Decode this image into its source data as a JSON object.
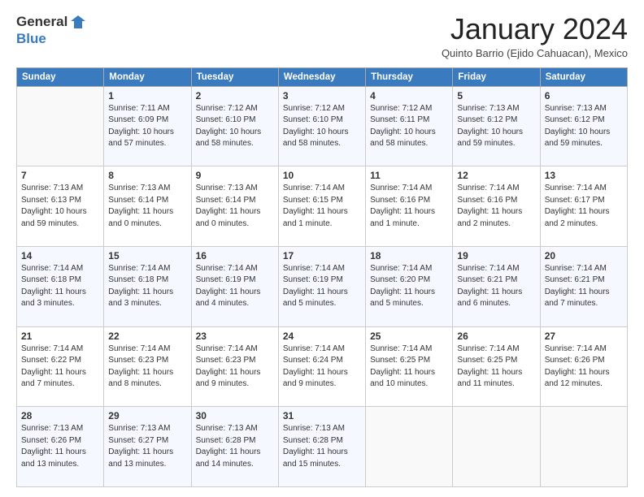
{
  "logo": {
    "general": "General",
    "blue": "Blue"
  },
  "title": "January 2024",
  "location": "Quinto Barrio (Ejido Cahuacan), Mexico",
  "days_header": [
    "Sunday",
    "Monday",
    "Tuesday",
    "Wednesday",
    "Thursday",
    "Friday",
    "Saturday"
  ],
  "weeks": [
    [
      {
        "day": "",
        "sunrise": "",
        "sunset": "",
        "daylight": ""
      },
      {
        "day": "1",
        "sunrise": "Sunrise: 7:11 AM",
        "sunset": "Sunset: 6:09 PM",
        "daylight": "Daylight: 10 hours and 57 minutes."
      },
      {
        "day": "2",
        "sunrise": "Sunrise: 7:12 AM",
        "sunset": "Sunset: 6:10 PM",
        "daylight": "Daylight: 10 hours and 58 minutes."
      },
      {
        "day": "3",
        "sunrise": "Sunrise: 7:12 AM",
        "sunset": "Sunset: 6:10 PM",
        "daylight": "Daylight: 10 hours and 58 minutes."
      },
      {
        "day": "4",
        "sunrise": "Sunrise: 7:12 AM",
        "sunset": "Sunset: 6:11 PM",
        "daylight": "Daylight: 10 hours and 58 minutes."
      },
      {
        "day": "5",
        "sunrise": "Sunrise: 7:13 AM",
        "sunset": "Sunset: 6:12 PM",
        "daylight": "Daylight: 10 hours and 59 minutes."
      },
      {
        "day": "6",
        "sunrise": "Sunrise: 7:13 AM",
        "sunset": "Sunset: 6:12 PM",
        "daylight": "Daylight: 10 hours and 59 minutes."
      }
    ],
    [
      {
        "day": "7",
        "sunrise": "Sunrise: 7:13 AM",
        "sunset": "Sunset: 6:13 PM",
        "daylight": "Daylight: 10 hours and 59 minutes."
      },
      {
        "day": "8",
        "sunrise": "Sunrise: 7:13 AM",
        "sunset": "Sunset: 6:14 PM",
        "daylight": "Daylight: 11 hours and 0 minutes."
      },
      {
        "day": "9",
        "sunrise": "Sunrise: 7:13 AM",
        "sunset": "Sunset: 6:14 PM",
        "daylight": "Daylight: 11 hours and 0 minutes."
      },
      {
        "day": "10",
        "sunrise": "Sunrise: 7:14 AM",
        "sunset": "Sunset: 6:15 PM",
        "daylight": "Daylight: 11 hours and 1 minute."
      },
      {
        "day": "11",
        "sunrise": "Sunrise: 7:14 AM",
        "sunset": "Sunset: 6:16 PM",
        "daylight": "Daylight: 11 hours and 1 minute."
      },
      {
        "day": "12",
        "sunrise": "Sunrise: 7:14 AM",
        "sunset": "Sunset: 6:16 PM",
        "daylight": "Daylight: 11 hours and 2 minutes."
      },
      {
        "day": "13",
        "sunrise": "Sunrise: 7:14 AM",
        "sunset": "Sunset: 6:17 PM",
        "daylight": "Daylight: 11 hours and 2 minutes."
      }
    ],
    [
      {
        "day": "14",
        "sunrise": "Sunrise: 7:14 AM",
        "sunset": "Sunset: 6:18 PM",
        "daylight": "Daylight: 11 hours and 3 minutes."
      },
      {
        "day": "15",
        "sunrise": "Sunrise: 7:14 AM",
        "sunset": "Sunset: 6:18 PM",
        "daylight": "Daylight: 11 hours and 3 minutes."
      },
      {
        "day": "16",
        "sunrise": "Sunrise: 7:14 AM",
        "sunset": "Sunset: 6:19 PM",
        "daylight": "Daylight: 11 hours and 4 minutes."
      },
      {
        "day": "17",
        "sunrise": "Sunrise: 7:14 AM",
        "sunset": "Sunset: 6:19 PM",
        "daylight": "Daylight: 11 hours and 5 minutes."
      },
      {
        "day": "18",
        "sunrise": "Sunrise: 7:14 AM",
        "sunset": "Sunset: 6:20 PM",
        "daylight": "Daylight: 11 hours and 5 minutes."
      },
      {
        "day": "19",
        "sunrise": "Sunrise: 7:14 AM",
        "sunset": "Sunset: 6:21 PM",
        "daylight": "Daylight: 11 hours and 6 minutes."
      },
      {
        "day": "20",
        "sunrise": "Sunrise: 7:14 AM",
        "sunset": "Sunset: 6:21 PM",
        "daylight": "Daylight: 11 hours and 7 minutes."
      }
    ],
    [
      {
        "day": "21",
        "sunrise": "Sunrise: 7:14 AM",
        "sunset": "Sunset: 6:22 PM",
        "daylight": "Daylight: 11 hours and 7 minutes."
      },
      {
        "day": "22",
        "sunrise": "Sunrise: 7:14 AM",
        "sunset": "Sunset: 6:23 PM",
        "daylight": "Daylight: 11 hours and 8 minutes."
      },
      {
        "day": "23",
        "sunrise": "Sunrise: 7:14 AM",
        "sunset": "Sunset: 6:23 PM",
        "daylight": "Daylight: 11 hours and 9 minutes."
      },
      {
        "day": "24",
        "sunrise": "Sunrise: 7:14 AM",
        "sunset": "Sunset: 6:24 PM",
        "daylight": "Daylight: 11 hours and 9 minutes."
      },
      {
        "day": "25",
        "sunrise": "Sunrise: 7:14 AM",
        "sunset": "Sunset: 6:25 PM",
        "daylight": "Daylight: 11 hours and 10 minutes."
      },
      {
        "day": "26",
        "sunrise": "Sunrise: 7:14 AM",
        "sunset": "Sunset: 6:25 PM",
        "daylight": "Daylight: 11 hours and 11 minutes."
      },
      {
        "day": "27",
        "sunrise": "Sunrise: 7:14 AM",
        "sunset": "Sunset: 6:26 PM",
        "daylight": "Daylight: 11 hours and 12 minutes."
      }
    ],
    [
      {
        "day": "28",
        "sunrise": "Sunrise: 7:13 AM",
        "sunset": "Sunset: 6:26 PM",
        "daylight": "Daylight: 11 hours and 13 minutes."
      },
      {
        "day": "29",
        "sunrise": "Sunrise: 7:13 AM",
        "sunset": "Sunset: 6:27 PM",
        "daylight": "Daylight: 11 hours and 13 minutes."
      },
      {
        "day": "30",
        "sunrise": "Sunrise: 7:13 AM",
        "sunset": "Sunset: 6:28 PM",
        "daylight": "Daylight: 11 hours and 14 minutes."
      },
      {
        "day": "31",
        "sunrise": "Sunrise: 7:13 AM",
        "sunset": "Sunset: 6:28 PM",
        "daylight": "Daylight: 11 hours and 15 minutes."
      },
      {
        "day": "",
        "sunrise": "",
        "sunset": "",
        "daylight": ""
      },
      {
        "day": "",
        "sunrise": "",
        "sunset": "",
        "daylight": ""
      },
      {
        "day": "",
        "sunrise": "",
        "sunset": "",
        "daylight": ""
      }
    ]
  ]
}
